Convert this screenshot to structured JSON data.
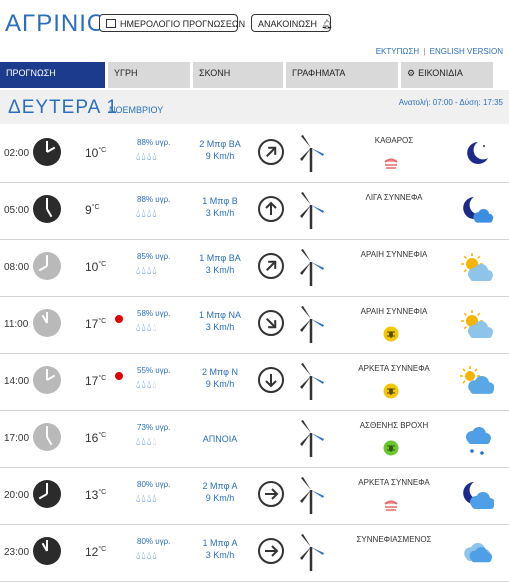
{
  "header": {
    "city": "ΑΓΡΙΝΙΟ",
    "calendar_button": "ΗΜΕΡΟΛΟΓΙΟ ΠΡΟΓΝΩΣΕΩΝ",
    "announcement_button": "ΑΝΑΚΟΙΝΩΣΗ"
  },
  "links": {
    "print": "ΕΚΤΥΠΩΣΗ",
    "separator": "|",
    "english": "ENGLISH VERSION"
  },
  "tabs": [
    {
      "label": "ΠΡΟΓΝΩΣΗ",
      "active": true
    },
    {
      "label": "ΥΓΡΗ",
      "active": false
    },
    {
      "label": "ΣΚΟΝΗ",
      "active": false
    },
    {
      "label": "ΓΡΑΦΗΜΑΤΑ",
      "active": false
    },
    {
      "label": "ΕΙΚΟΝΙΔΙΑ",
      "active": false,
      "icon": "gear-icon"
    }
  ],
  "day": {
    "name": "ΔΕΥΤΕΡΑ 1",
    "month": "ΝΟΕΜΒΡΙΟΥ",
    "sunrise_sunset": "Ανατολή: 07:00 - Δύση: 17:35"
  },
  "forecast": [
    {
      "time": "02:00",
      "clock": "dark",
      "temp": "10",
      "unit": "°C",
      "warning": false,
      "humidity": "88% υγρ.",
      "drops": 4,
      "wind_force": "2 Μπφ ΒΑ",
      "wind_speed": "9 Km/h",
      "wind_dir": "NE",
      "sky": "ΚΑΘΑΡΟΣ",
      "mini_icon": "haze-icon",
      "weather_icon": "moon-icon"
    },
    {
      "time": "05:00",
      "clock": "dark",
      "temp": "9",
      "unit": "°C",
      "warning": false,
      "humidity": "88% υγρ.",
      "drops": 4,
      "wind_force": "1 Μπφ Β",
      "wind_speed": "3 Km/h",
      "wind_dir": "N",
      "sky": "ΛΙΓΑ ΣΥΝΝΕΦΑ",
      "mini_icon": "",
      "weather_icon": "moon-cloud-icon"
    },
    {
      "time": "08:00",
      "clock": "light",
      "temp": "10",
      "unit": "°C",
      "warning": false,
      "humidity": "85% υγρ.",
      "drops": 4,
      "wind_force": "1 Μπφ ΒΑ",
      "wind_speed": "3 Km/h",
      "wind_dir": "NE",
      "sky": "ΑΡΑΙΗ ΣΥΝΝΕΦΙΑ",
      "mini_icon": "",
      "weather_icon": "sun-cloud-icon"
    },
    {
      "time": "11:00",
      "clock": "light",
      "temp": "17",
      "unit": "°C",
      "warning": true,
      "humidity": "58% υγρ.",
      "drops": 3,
      "wind_force": "1 Μπφ ΝΑ",
      "wind_speed": "3 Km/h",
      "wind_dir": "SE",
      "sky": "ΑΡΑΙΗ ΣΥΝΝΕΦΙΑ",
      "mini_icon": "insect-icon",
      "weather_icon": "sun-cloud-icon"
    },
    {
      "time": "14:00",
      "clock": "light",
      "temp": "17",
      "unit": "°C",
      "warning": true,
      "humidity": "55% υγρ.",
      "drops": 3,
      "wind_force": "2 Μπφ Ν",
      "wind_speed": "9 Km/h",
      "wind_dir": "S",
      "sky": "ΑΡΚΕΤΑ ΣΥΝΝΕΦΑ",
      "mini_icon": "insect-icon",
      "weather_icon": "sun-clouds-icon"
    },
    {
      "time": "17:00",
      "clock": "light",
      "temp": "16",
      "unit": "°C",
      "warning": false,
      "humidity": "73% υγρ.",
      "drops": 3,
      "wind_force": "ΑΠΝΟΙΑ",
      "wind_speed": "",
      "wind_dir": "",
      "sky": "ΑΣΘΕΝΗΣ ΒΡΟΧΗ",
      "mini_icon": "insect-green-icon",
      "weather_icon": "rain-cloud-icon"
    },
    {
      "time": "20:00",
      "clock": "dark",
      "temp": "13",
      "unit": "°C",
      "warning": false,
      "humidity": "80% υγρ.",
      "drops": 4,
      "wind_force": "2 Μπφ Α",
      "wind_speed": "9 Km/h",
      "wind_dir": "E",
      "sky": "ΑΡΚΕΤΑ ΣΥΝΝΕΦΑ",
      "mini_icon": "haze-icon",
      "weather_icon": "moon-clouds-icon"
    },
    {
      "time": "23:00",
      "clock": "dark",
      "temp": "12",
      "unit": "°C",
      "warning": false,
      "humidity": "80% υγρ.",
      "drops": 4,
      "wind_force": "1 Μπφ Α",
      "wind_speed": "3 Km/h",
      "wind_dir": "E",
      "sky": "ΣΥΝΝΕΦΙΑΣΜΕΝΟΣ",
      "mini_icon": "",
      "weather_icon": "clouds-icon"
    }
  ],
  "colors": {
    "accent": "#2a6fbc",
    "active_tab": "#1c3b8c",
    "warning": "#e00000"
  }
}
